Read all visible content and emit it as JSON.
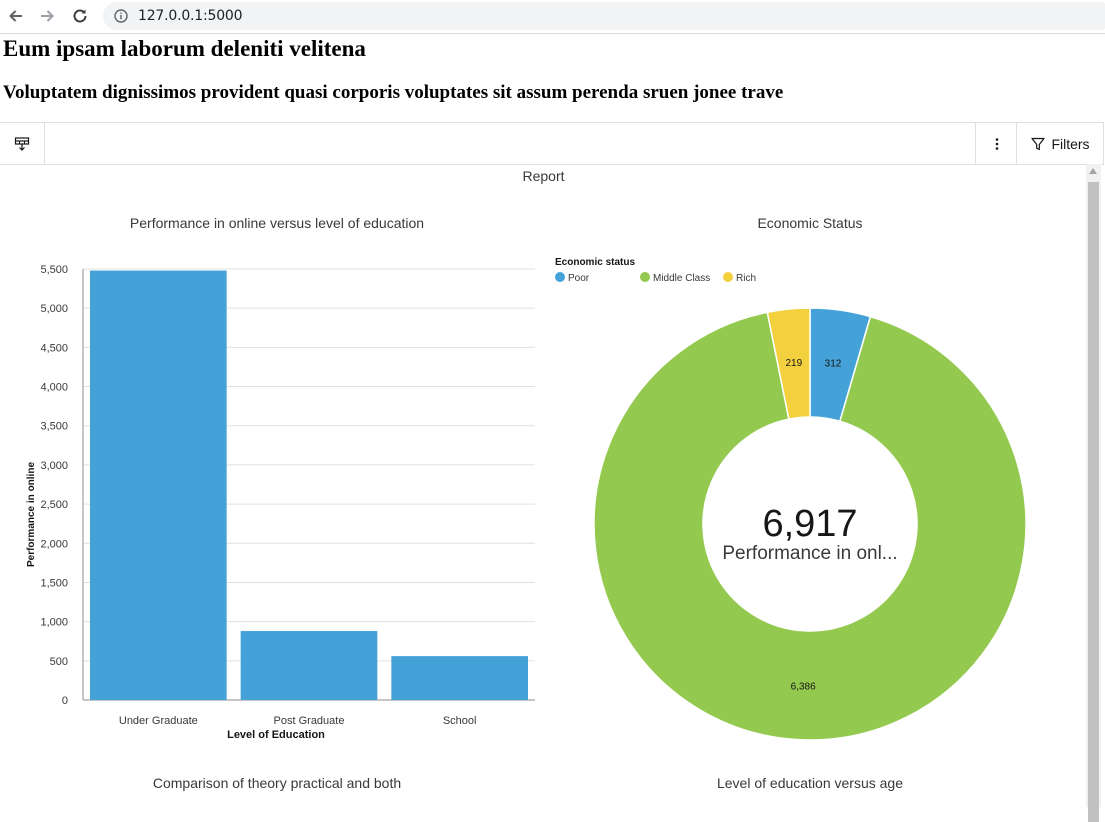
{
  "browser": {
    "url": "127.0.0.1:5000"
  },
  "page": {
    "title": "Eum ipsam laborum deleniti velitena",
    "subtitle": "Voluptatem dignissimos provident quasi corporis voluptates sit assum perenda sruen jonee trave"
  },
  "toolbar": {
    "filters_label": "Filters"
  },
  "report": {
    "title": "Report",
    "bottom_titles": [
      "Comparison of theory practical and both",
      "Level of education versus age"
    ]
  },
  "colors": {
    "blue": "#45a2d8",
    "green": "#93c94f",
    "yellow": "#f3d03e"
  },
  "chart_data": [
    {
      "type": "bar",
      "title": "Performance in online versus level of education",
      "xlabel": "Level of Education",
      "ylabel": "Performance in online",
      "categories": [
        "Under Graduate",
        "Post Graduate",
        "School"
      ],
      "values": [
        5480,
        880,
        560
      ],
      "ylim": [
        0,
        5500
      ],
      "yticks": [
        0,
        500,
        1000,
        1500,
        2000,
        2500,
        3000,
        3500,
        4000,
        4500,
        5000,
        5500
      ],
      "ytick_labels": [
        "0",
        "500",
        "1,000",
        "1,500",
        "2,000",
        "2,500",
        "3,000",
        "3,500",
        "4,000",
        "4,500",
        "5,000",
        "5,500"
      ],
      "grid": true
    },
    {
      "type": "pie",
      "title": "Economic Status",
      "legend_title": "Economic status",
      "legend_position": "top-left",
      "slices": [
        {
          "name": "Poor",
          "value": 312,
          "label": "312",
          "color": "#45a2d8"
        },
        {
          "name": "Middle Class",
          "value": 6386,
          "label": "6,386",
          "color": "#93c94f"
        },
        {
          "name": "Rich",
          "value": 219,
          "label": "219",
          "color": "#f3d03e"
        }
      ],
      "center_value": "6,917",
      "center_label": "Performance in onl..."
    }
  ]
}
